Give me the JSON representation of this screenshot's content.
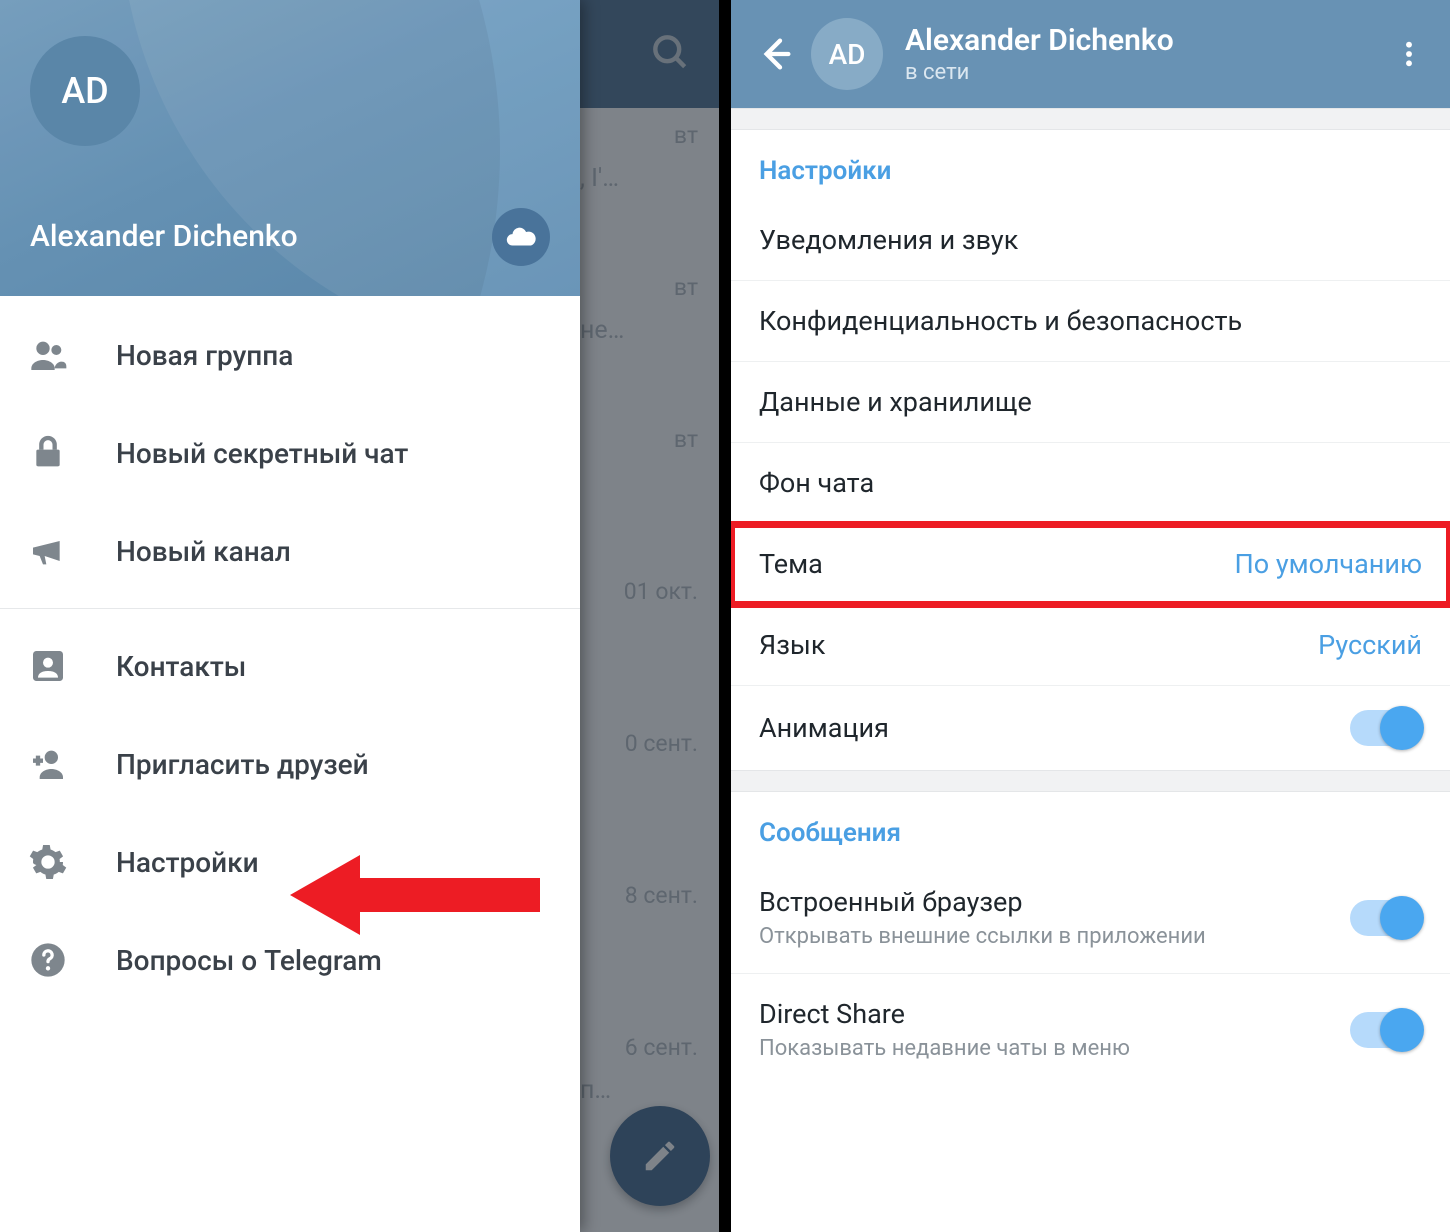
{
  "left": {
    "avatar_initials": "AD",
    "user_name": "Alexander Dichenko",
    "menu": {
      "new_group": "Новая группа",
      "new_secret_chat": "Новый секретный чат",
      "new_channel": "Новый канал",
      "contacts": "Контакты",
      "invite_friends": "Пригласить друзей",
      "settings": "Настройки",
      "faq": "Вопросы о Telegram"
    },
    "chat_peek": {
      "row0": {
        "date": "вт",
        "snippet": ", I'…"
      },
      "row1": {
        "date": "вт",
        "snippet": "не…"
      },
      "row2": {
        "date": "вт",
        "snippet": ""
      },
      "row3": {
        "date": "01 окт.",
        "snippet": ""
      },
      "row4": {
        "date": "0 сент.",
        "snippet": ""
      },
      "row5": {
        "date": "8 сент.",
        "snippet": ""
      },
      "row6": {
        "date": "6 сент.",
        "snippet": "п…"
      }
    }
  },
  "right": {
    "avatar_initials": "AD",
    "user_name": "Alexander Dichenko",
    "status": "в сети",
    "sections": {
      "settings_title": "Настройки",
      "messages_title": "Сообщения"
    },
    "rows": {
      "notifications": "Уведомления и звук",
      "privacy": "Конфиденциальность и безопасность",
      "data": "Данные и хранилище",
      "chat_bg": "Фон чата",
      "theme_label": "Тема",
      "theme_value": "По умолчанию",
      "language_label": "Язык",
      "language_value": "Русский",
      "animation": "Анимация",
      "inapp_browser": "Встроенный браузер",
      "inapp_browser_sub": "Открывать внешние ссылки в приложении",
      "direct_share": "Direct Share",
      "direct_share_sub": "Показывать недавние чаты в меню"
    }
  }
}
